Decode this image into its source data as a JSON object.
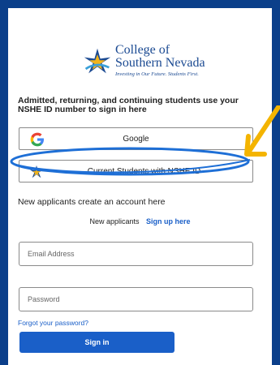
{
  "logo": {
    "line1": "College of",
    "line2": "Southern Nevada",
    "tagline": "Investing in Our Future. Students First."
  },
  "intro_text": "Admitted, returning, and continuing students use your NSHE ID number to sign in here",
  "buttons": {
    "google": {
      "label": "Google",
      "icon": "google-g-icon"
    },
    "nshe": {
      "label": "Current Students with NSHE ID",
      "icon": "csn-star-icon"
    }
  },
  "new_applicants": {
    "heading": "New applicants create an account here",
    "prompt": "New applicants",
    "link": "Sign up here"
  },
  "form": {
    "email_placeholder": "Email Address",
    "password_placeholder": "Password",
    "forgot_link": "Forgot your password?",
    "signin_label": "Sign in"
  },
  "colors": {
    "background": "#0b3f8a",
    "accent": "#1a5fc8",
    "annotation_ring": "#1e6fd6",
    "annotation_arrow": "#f4b400"
  }
}
